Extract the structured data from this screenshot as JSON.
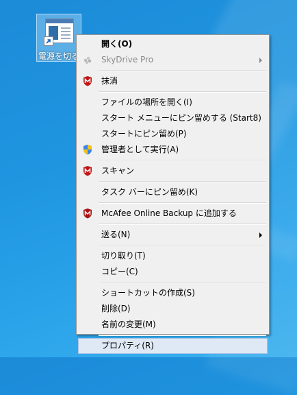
{
  "desktop": {
    "icon_label": "電源を切る"
  },
  "context_menu": {
    "items": [
      {
        "label": "開く(O)",
        "bold": true,
        "icon": ""
      },
      {
        "label": "SkyDrive Pro",
        "disabled": true,
        "submenu": true,
        "icon": "skydrive-icon"
      },
      {
        "label": "抹消",
        "icon": "mcafee-icon"
      },
      {
        "label": "ファイルの場所を開く(I)",
        "icon": ""
      },
      {
        "label": "スタート メニューにピン留めする (Start8)",
        "icon": ""
      },
      {
        "label": "スタートにピン留め(P)",
        "icon": ""
      },
      {
        "label": "管理者として実行(A)",
        "icon": "uac-shield-icon"
      },
      {
        "label": "スキャン",
        "icon": "mcafee-icon"
      },
      {
        "label": "タスク バーにピン留め(K)",
        "icon": ""
      },
      {
        "label": "McAfee Online Backup に追加する",
        "icon": "mcafee-backup-icon"
      },
      {
        "label": "送る(N)",
        "submenu": true,
        "icon": ""
      },
      {
        "label": "切り取り(T)",
        "icon": ""
      },
      {
        "label": "コピー(C)",
        "icon": ""
      },
      {
        "label": "ショートカットの作成(S)",
        "icon": ""
      },
      {
        "label": "削除(D)",
        "icon": ""
      },
      {
        "label": "名前の変更(M)",
        "icon": ""
      },
      {
        "label": "プロパティ(R)",
        "highlighted": true,
        "icon": ""
      }
    ]
  },
  "colors": {
    "desktop_background": "#1f95e0",
    "menu_background": "#f0f0f0",
    "menu_highlight": "#dfe9f5",
    "mcafee_red": "#c01818"
  }
}
